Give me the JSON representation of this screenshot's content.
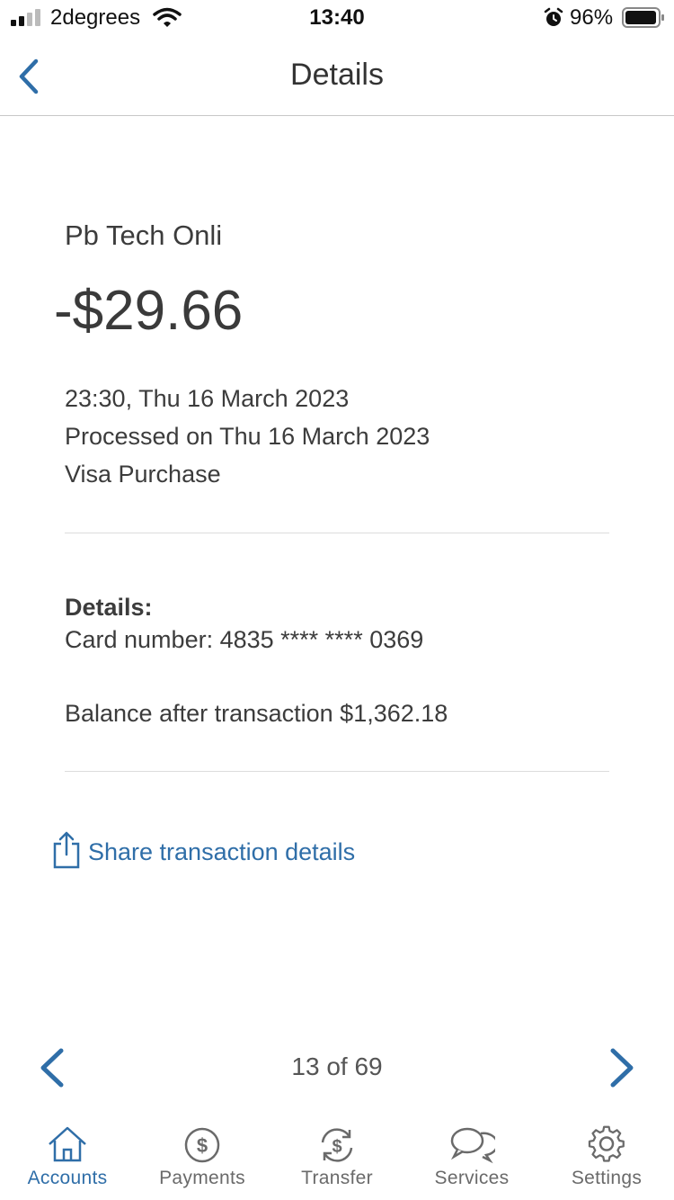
{
  "status_bar": {
    "carrier": "2degrees",
    "time": "13:40",
    "battery": "96%"
  },
  "nav": {
    "title": "Details",
    "back_icon": "chevron-left-icon"
  },
  "transaction": {
    "merchant": "Pb Tech Onli",
    "amount": "-$29.66",
    "datetime": "23:30, Thu 16 March 2023",
    "processed": "Processed on Thu 16 March 2023",
    "type": "Visa Purchase",
    "details_label": "Details:",
    "card_number": "Card number: 4835 **** **** 0369",
    "balance": "Balance after transaction $1,362.18"
  },
  "share": {
    "label": "Share transaction details",
    "icon": "share-icon"
  },
  "pager": {
    "text": "13 of 69"
  },
  "tabs": [
    {
      "label": "Accounts",
      "icon": "home-icon",
      "active": true
    },
    {
      "label": "Payments",
      "icon": "dollar-circle-icon",
      "active": false
    },
    {
      "label": "Transfer",
      "icon": "transfer-icon",
      "active": false
    },
    {
      "label": "Services",
      "icon": "chat-bubbles-icon",
      "active": false
    },
    {
      "label": "Settings",
      "icon": "gear-icon",
      "active": false
    }
  ],
  "colors": {
    "accent": "#2f6ea8",
    "text": "#3c3c3c",
    "divider": "#dcdcdc"
  }
}
